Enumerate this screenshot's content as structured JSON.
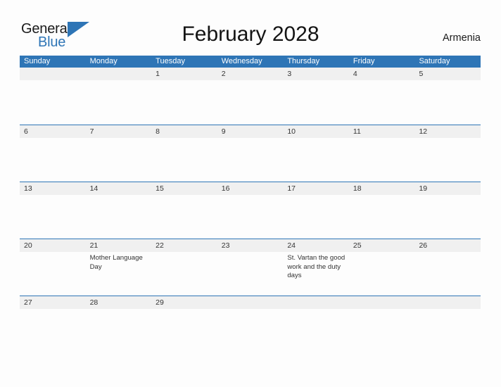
{
  "brand": {
    "name_part1": "General",
    "name_part2": "Blue",
    "flag_icon": "flag-triangle-icon",
    "color_primary": "#2E75B6",
    "color_text": "#1A1A1A"
  },
  "header": {
    "title": "February 2028",
    "country": "Armenia"
  },
  "calendar": {
    "header_color": "#2E75B6",
    "band_color": "#F0F0F0",
    "day_names": [
      "Sunday",
      "Monday",
      "Tuesday",
      "Wednesday",
      "Thursday",
      "Friday",
      "Saturday"
    ],
    "weeks": [
      {
        "days": [
          {
            "num": "",
            "events": []
          },
          {
            "num": "",
            "events": []
          },
          {
            "num": "1",
            "events": []
          },
          {
            "num": "2",
            "events": []
          },
          {
            "num": "3",
            "events": []
          },
          {
            "num": "4",
            "events": []
          },
          {
            "num": "5",
            "events": []
          }
        ]
      },
      {
        "days": [
          {
            "num": "6",
            "events": []
          },
          {
            "num": "7",
            "events": []
          },
          {
            "num": "8",
            "events": []
          },
          {
            "num": "9",
            "events": []
          },
          {
            "num": "10",
            "events": []
          },
          {
            "num": "11",
            "events": []
          },
          {
            "num": "12",
            "events": []
          }
        ]
      },
      {
        "days": [
          {
            "num": "13",
            "events": []
          },
          {
            "num": "14",
            "events": []
          },
          {
            "num": "15",
            "events": []
          },
          {
            "num": "16",
            "events": []
          },
          {
            "num": "17",
            "events": []
          },
          {
            "num": "18",
            "events": []
          },
          {
            "num": "19",
            "events": []
          }
        ]
      },
      {
        "days": [
          {
            "num": "20",
            "events": []
          },
          {
            "num": "21",
            "events": [
              "Mother Language Day"
            ]
          },
          {
            "num": "22",
            "events": []
          },
          {
            "num": "23",
            "events": []
          },
          {
            "num": "24",
            "events": [
              "St. Vartan the good work and the duty days"
            ]
          },
          {
            "num": "25",
            "events": []
          },
          {
            "num": "26",
            "events": []
          }
        ]
      },
      {
        "days": [
          {
            "num": "27",
            "events": []
          },
          {
            "num": "28",
            "events": []
          },
          {
            "num": "29",
            "events": []
          },
          {
            "num": "",
            "events": []
          },
          {
            "num": "",
            "events": []
          },
          {
            "num": "",
            "events": []
          },
          {
            "num": "",
            "events": []
          }
        ]
      }
    ]
  }
}
